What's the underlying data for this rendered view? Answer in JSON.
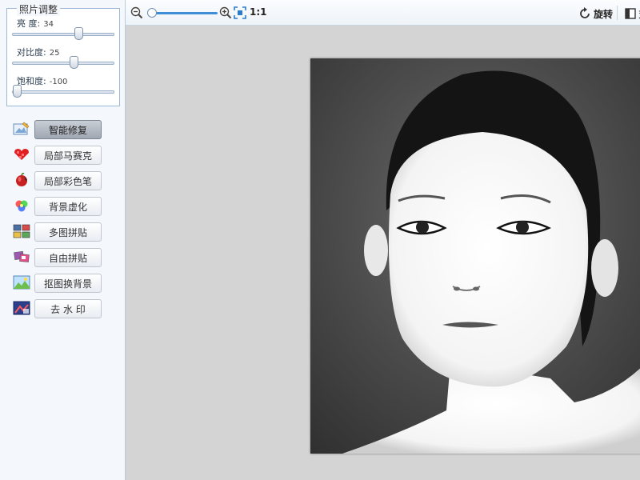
{
  "adjust": {
    "title": "照片调整",
    "brightness": {
      "label": "亮 度:",
      "value": "34",
      "fraction": 0.67
    },
    "contrast": {
      "label": "对比度:",
      "value": "25",
      "fraction": 0.62
    },
    "saturation": {
      "label": "饱和度:",
      "value": "-100",
      "fraction": 0.0
    }
  },
  "tools": [
    {
      "label": "智能修复",
      "icon": "smart-repair-icon",
      "active": true
    },
    {
      "label": "局部马赛克",
      "icon": "mosaic-heart-icon",
      "active": false
    },
    {
      "label": "局部彩色笔",
      "icon": "color-pen-apple-icon",
      "active": false
    },
    {
      "label": "背景虚化",
      "icon": "blur-color-dots-icon",
      "active": false
    },
    {
      "label": "多图拼贴",
      "icon": "multi-collage-icon",
      "active": false
    },
    {
      "label": "自由拼贴",
      "icon": "free-collage-icon",
      "active": false
    },
    {
      "label": "抠图换背景",
      "icon": "cutout-background-icon",
      "active": false
    },
    {
      "label": "去 水 印",
      "icon": "remove-watermark-icon",
      "active": false
    }
  ],
  "toolbar": {
    "zoom_level": 0.0,
    "ratio_label": "1:1",
    "rotate_label": "旋转",
    "compare_label": "对"
  },
  "colors": {
    "accent": "#3d8ed6",
    "panel_bg": "#f4f8fd",
    "canvas_bg": "#d4d4d4"
  }
}
